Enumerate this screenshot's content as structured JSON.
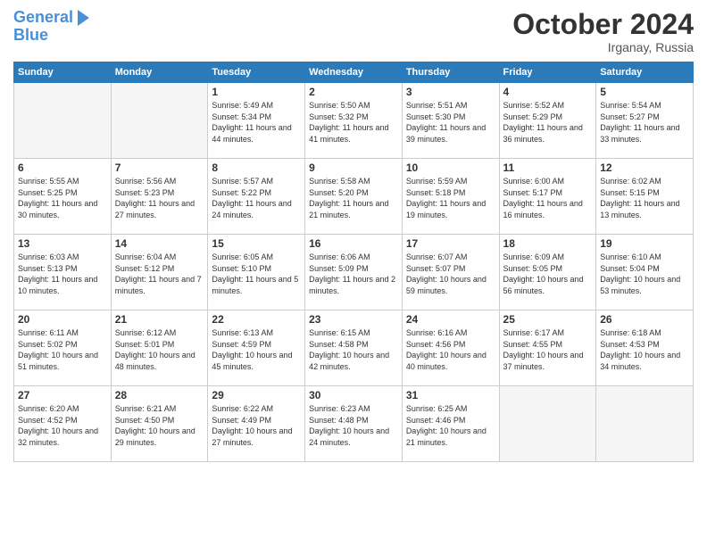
{
  "header": {
    "logo_line1": "General",
    "logo_line2": "Blue",
    "month": "October 2024",
    "location": "Irganay, Russia"
  },
  "weekdays": [
    "Sunday",
    "Monday",
    "Tuesday",
    "Wednesday",
    "Thursday",
    "Friday",
    "Saturday"
  ],
  "weeks": [
    [
      {
        "day": "",
        "info": ""
      },
      {
        "day": "",
        "info": ""
      },
      {
        "day": "1",
        "info": "Sunrise: 5:49 AM\nSunset: 5:34 PM\nDaylight: 11 hours and 44 minutes."
      },
      {
        "day": "2",
        "info": "Sunrise: 5:50 AM\nSunset: 5:32 PM\nDaylight: 11 hours and 41 minutes."
      },
      {
        "day": "3",
        "info": "Sunrise: 5:51 AM\nSunset: 5:30 PM\nDaylight: 11 hours and 39 minutes."
      },
      {
        "day": "4",
        "info": "Sunrise: 5:52 AM\nSunset: 5:29 PM\nDaylight: 11 hours and 36 minutes."
      },
      {
        "day": "5",
        "info": "Sunrise: 5:54 AM\nSunset: 5:27 PM\nDaylight: 11 hours and 33 minutes."
      }
    ],
    [
      {
        "day": "6",
        "info": "Sunrise: 5:55 AM\nSunset: 5:25 PM\nDaylight: 11 hours and 30 minutes."
      },
      {
        "day": "7",
        "info": "Sunrise: 5:56 AM\nSunset: 5:23 PM\nDaylight: 11 hours and 27 minutes."
      },
      {
        "day": "8",
        "info": "Sunrise: 5:57 AM\nSunset: 5:22 PM\nDaylight: 11 hours and 24 minutes."
      },
      {
        "day": "9",
        "info": "Sunrise: 5:58 AM\nSunset: 5:20 PM\nDaylight: 11 hours and 21 minutes."
      },
      {
        "day": "10",
        "info": "Sunrise: 5:59 AM\nSunset: 5:18 PM\nDaylight: 11 hours and 19 minutes."
      },
      {
        "day": "11",
        "info": "Sunrise: 6:00 AM\nSunset: 5:17 PM\nDaylight: 11 hours and 16 minutes."
      },
      {
        "day": "12",
        "info": "Sunrise: 6:02 AM\nSunset: 5:15 PM\nDaylight: 11 hours and 13 minutes."
      }
    ],
    [
      {
        "day": "13",
        "info": "Sunrise: 6:03 AM\nSunset: 5:13 PM\nDaylight: 11 hours and 10 minutes."
      },
      {
        "day": "14",
        "info": "Sunrise: 6:04 AM\nSunset: 5:12 PM\nDaylight: 11 hours and 7 minutes."
      },
      {
        "day": "15",
        "info": "Sunrise: 6:05 AM\nSunset: 5:10 PM\nDaylight: 11 hours and 5 minutes."
      },
      {
        "day": "16",
        "info": "Sunrise: 6:06 AM\nSunset: 5:09 PM\nDaylight: 11 hours and 2 minutes."
      },
      {
        "day": "17",
        "info": "Sunrise: 6:07 AM\nSunset: 5:07 PM\nDaylight: 10 hours and 59 minutes."
      },
      {
        "day": "18",
        "info": "Sunrise: 6:09 AM\nSunset: 5:05 PM\nDaylight: 10 hours and 56 minutes."
      },
      {
        "day": "19",
        "info": "Sunrise: 6:10 AM\nSunset: 5:04 PM\nDaylight: 10 hours and 53 minutes."
      }
    ],
    [
      {
        "day": "20",
        "info": "Sunrise: 6:11 AM\nSunset: 5:02 PM\nDaylight: 10 hours and 51 minutes."
      },
      {
        "day": "21",
        "info": "Sunrise: 6:12 AM\nSunset: 5:01 PM\nDaylight: 10 hours and 48 minutes."
      },
      {
        "day": "22",
        "info": "Sunrise: 6:13 AM\nSunset: 4:59 PM\nDaylight: 10 hours and 45 minutes."
      },
      {
        "day": "23",
        "info": "Sunrise: 6:15 AM\nSunset: 4:58 PM\nDaylight: 10 hours and 42 minutes."
      },
      {
        "day": "24",
        "info": "Sunrise: 6:16 AM\nSunset: 4:56 PM\nDaylight: 10 hours and 40 minutes."
      },
      {
        "day": "25",
        "info": "Sunrise: 6:17 AM\nSunset: 4:55 PM\nDaylight: 10 hours and 37 minutes."
      },
      {
        "day": "26",
        "info": "Sunrise: 6:18 AM\nSunset: 4:53 PM\nDaylight: 10 hours and 34 minutes."
      }
    ],
    [
      {
        "day": "27",
        "info": "Sunrise: 6:20 AM\nSunset: 4:52 PM\nDaylight: 10 hours and 32 minutes."
      },
      {
        "day": "28",
        "info": "Sunrise: 6:21 AM\nSunset: 4:50 PM\nDaylight: 10 hours and 29 minutes."
      },
      {
        "day": "29",
        "info": "Sunrise: 6:22 AM\nSunset: 4:49 PM\nDaylight: 10 hours and 27 minutes."
      },
      {
        "day": "30",
        "info": "Sunrise: 6:23 AM\nSunset: 4:48 PM\nDaylight: 10 hours and 24 minutes."
      },
      {
        "day": "31",
        "info": "Sunrise: 6:25 AM\nSunset: 4:46 PM\nDaylight: 10 hours and 21 minutes."
      },
      {
        "day": "",
        "info": ""
      },
      {
        "day": "",
        "info": ""
      }
    ]
  ]
}
